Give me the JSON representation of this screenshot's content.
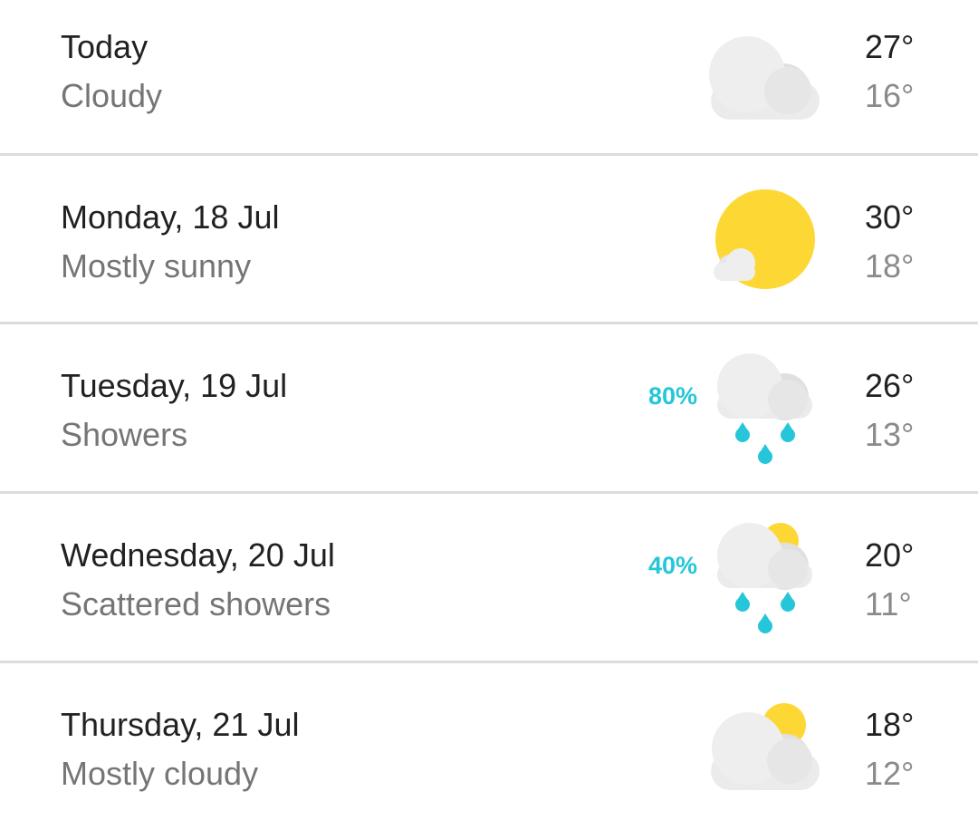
{
  "forecast": [
    {
      "day": "Today",
      "condition": "Cloudy",
      "high": "27°",
      "low": "16°",
      "precipitation": "",
      "icon": "cloudy-icon"
    },
    {
      "day": "Monday, 18 Jul",
      "condition": "Mostly sunny",
      "high": "30°",
      "low": "18°",
      "precipitation": "",
      "icon": "mostly-sunny-icon"
    },
    {
      "day": "Tuesday, 19 Jul",
      "condition": "Showers",
      "high": "26°",
      "low": "13°",
      "precipitation": "80%",
      "icon": "showers-icon"
    },
    {
      "day": "Wednesday, 20 Jul",
      "condition": "Scattered showers",
      "high": "20°",
      "low": "11°",
      "precipitation": "40%",
      "icon": "scattered-showers-icon"
    },
    {
      "day": "Thursday, 21 Jul",
      "condition": "Mostly cloudy",
      "high": "18°",
      "low": "12°",
      "precipitation": "",
      "icon": "mostly-cloudy-icon"
    }
  ],
  "colors": {
    "cloud": "#e8e8e8",
    "sun": "#fdd835",
    "rain": "#26c6da",
    "divider": "#dcdcdc",
    "primary_text": "#212121",
    "secondary_text": "#757575"
  }
}
